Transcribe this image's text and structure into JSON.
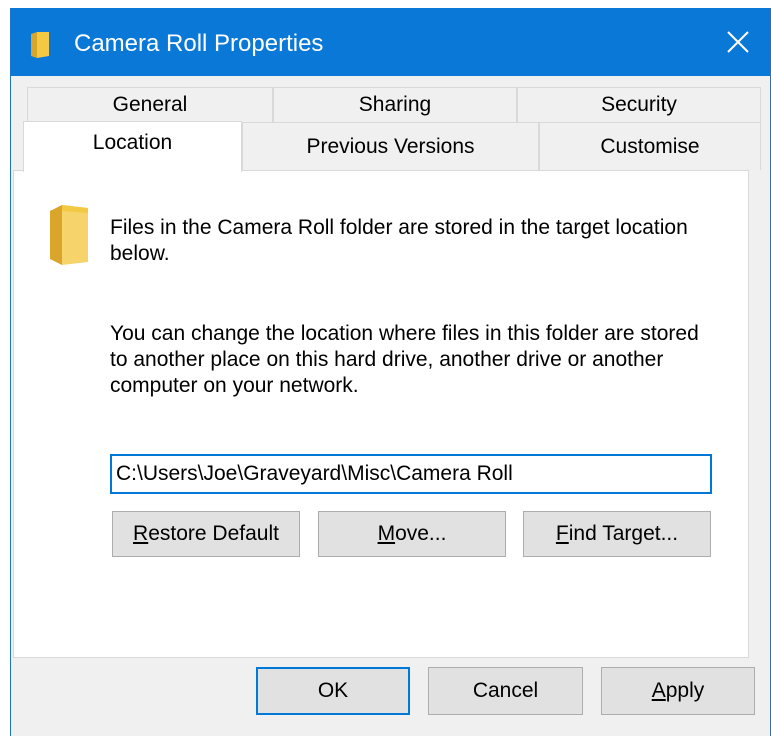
{
  "window": {
    "title": "Camera Roll Properties",
    "accent_color": "#0a78d7",
    "folder_color": "#f3c843"
  },
  "tabs": {
    "row1": [
      {
        "label": "General"
      },
      {
        "label": "Sharing"
      },
      {
        "label": "Security"
      }
    ],
    "row2": [
      {
        "label": "Location",
        "active": true
      },
      {
        "label": "Previous Versions"
      },
      {
        "label": "Customise"
      }
    ]
  },
  "location": {
    "intro_text": "Files in the Camera Roll folder are stored in the target location below.",
    "help_text": "You can change the location where files in this folder are stored to another place on this hard drive, another drive or another computer on your network.",
    "path_value": "C:\\Users\\Joe\\Graveyard\\Misc\\Camera Roll",
    "buttons": {
      "restore_mnemonic": "R",
      "restore_rest": "estore Default",
      "move_mnemonic": "M",
      "move_rest": "ove...",
      "find_mnemonic": "F",
      "find_rest": "ind Target..."
    }
  },
  "footer": {
    "ok_label": "OK",
    "cancel_label": "Cancel",
    "apply_mnemonic": "A",
    "apply_rest": "pply"
  },
  "icons": {
    "title_icon": "folder-icon",
    "panel_icon": "folder-icon",
    "close_icon": "close-icon"
  }
}
